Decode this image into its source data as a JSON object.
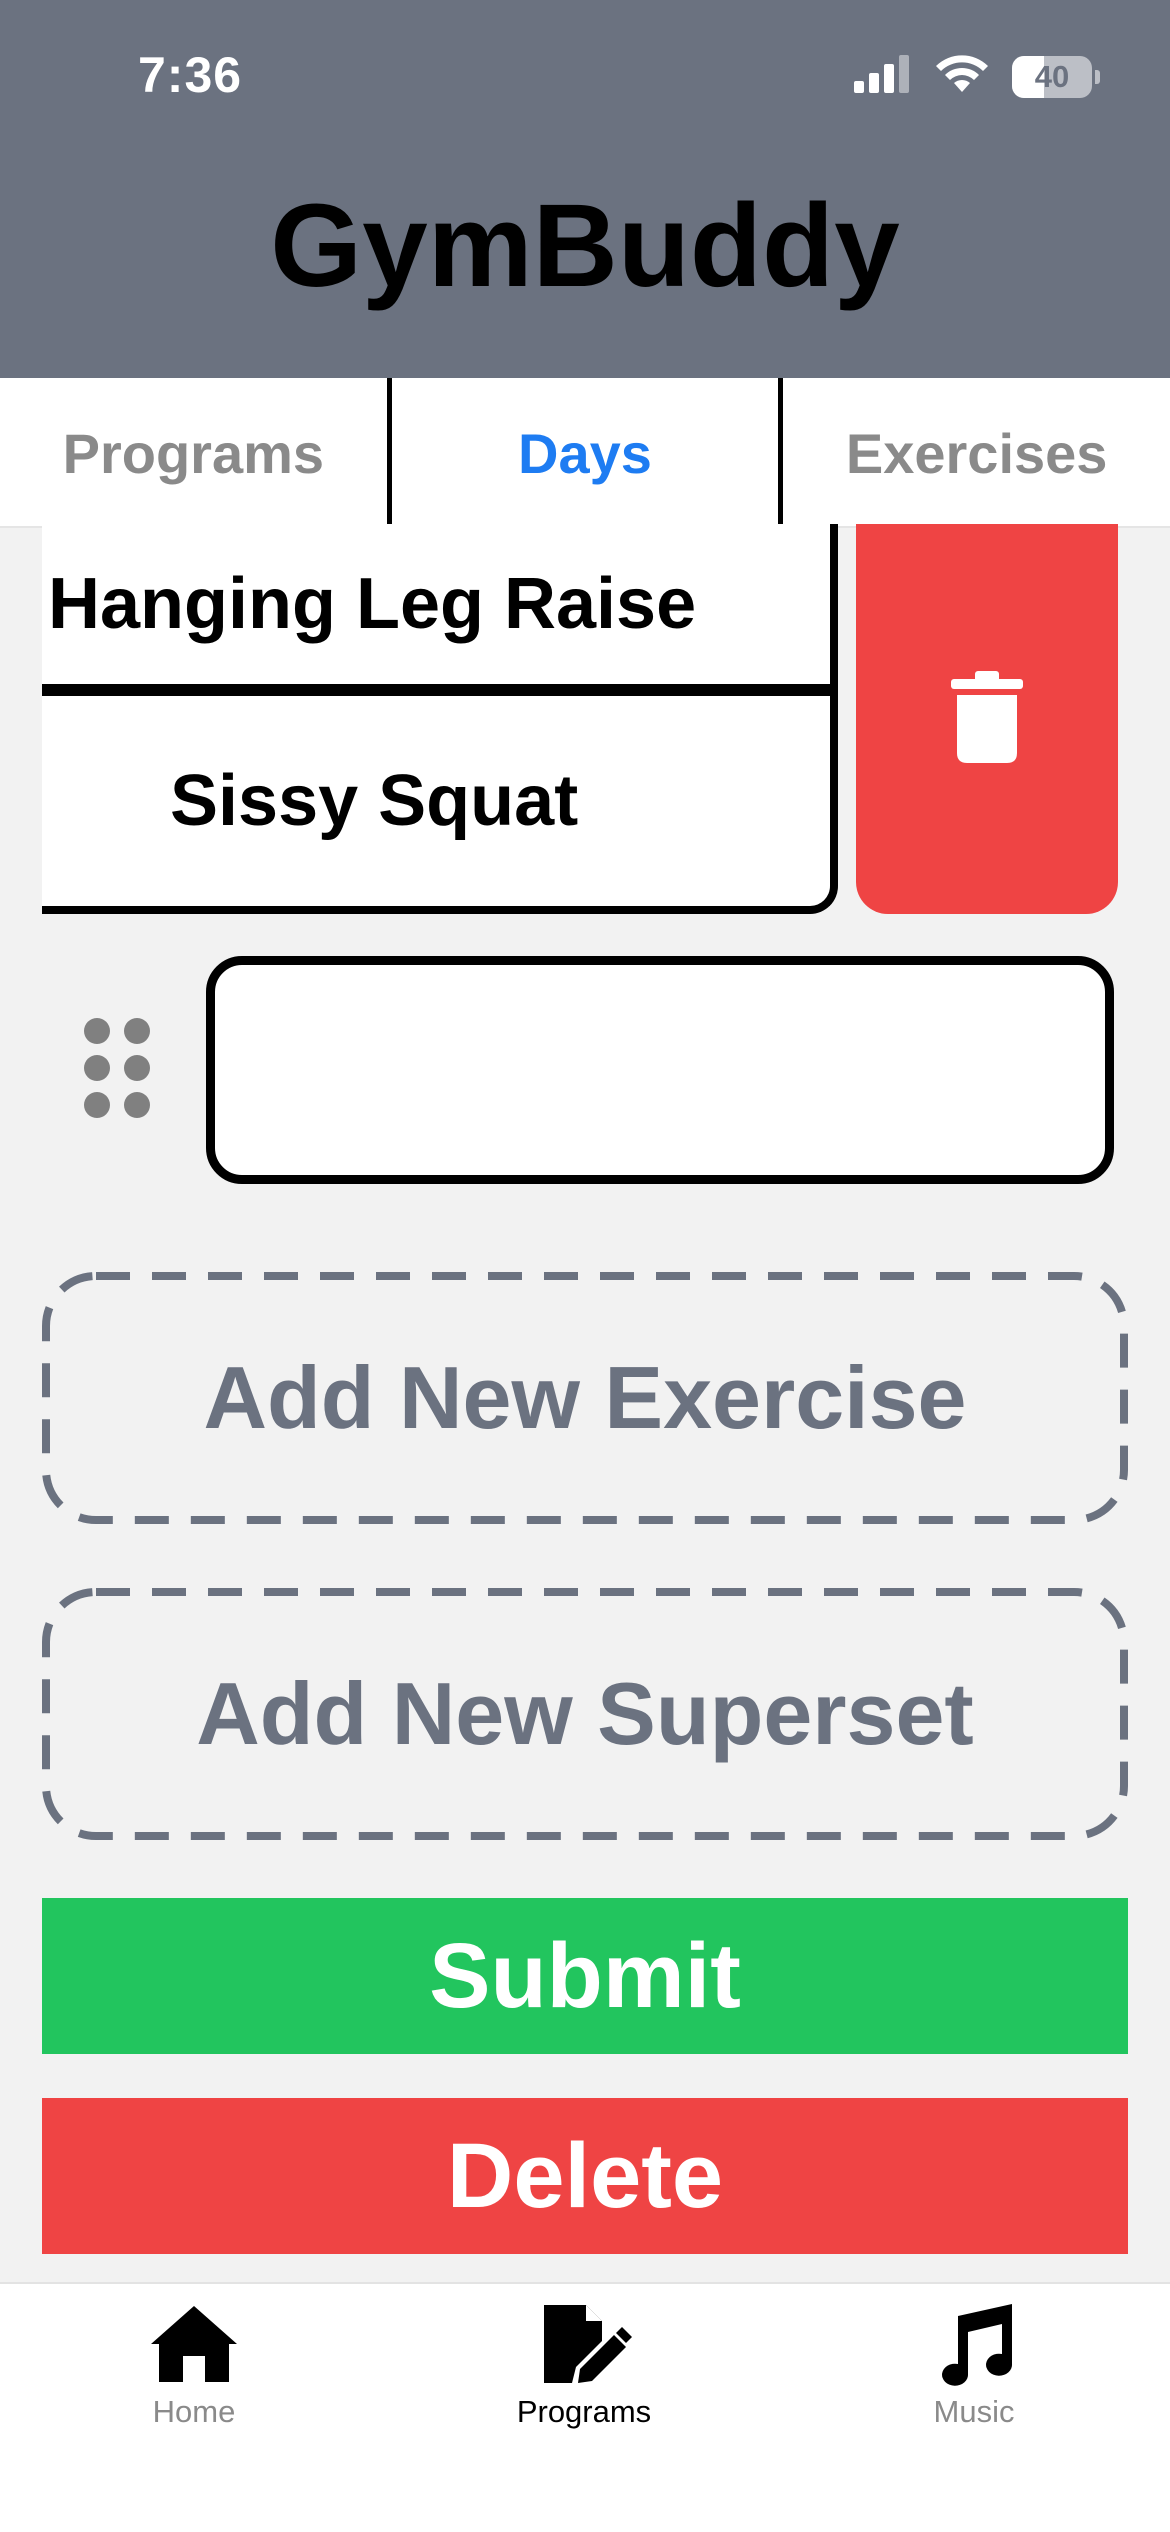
{
  "status_bar": {
    "time": "7:36",
    "battery": "40"
  },
  "header": {
    "title": "GymBuddy"
  },
  "tabs": [
    {
      "label": "Programs",
      "active": false
    },
    {
      "label": "Days",
      "active": true
    },
    {
      "label": "Exercises",
      "active": false
    }
  ],
  "exercise_group": {
    "items": [
      "Hanging Leg Raise",
      "Sissy Squat"
    ],
    "delete_icon": "trash-icon"
  },
  "new_exercise_input": {
    "value": "",
    "placeholder": "",
    "drag_icon": "drag-handle-icon"
  },
  "actions": {
    "add_exercise": "Add New Exercise",
    "add_superset": "Add New Superset",
    "submit": "Submit",
    "delete": "Delete"
  },
  "bottom_nav": {
    "items": [
      {
        "label": "Home",
        "icon": "home-icon",
        "active": false
      },
      {
        "label": "Programs",
        "icon": "edit-icon",
        "active": true
      },
      {
        "label": "Music",
        "icon": "music-icon",
        "active": false
      }
    ]
  },
  "colors": {
    "header_bg": "#6b7280",
    "active_tab": "#1e7cf2",
    "submit": "#22c55e",
    "delete": "#ef4444",
    "dashed_text": "#6b7280"
  }
}
